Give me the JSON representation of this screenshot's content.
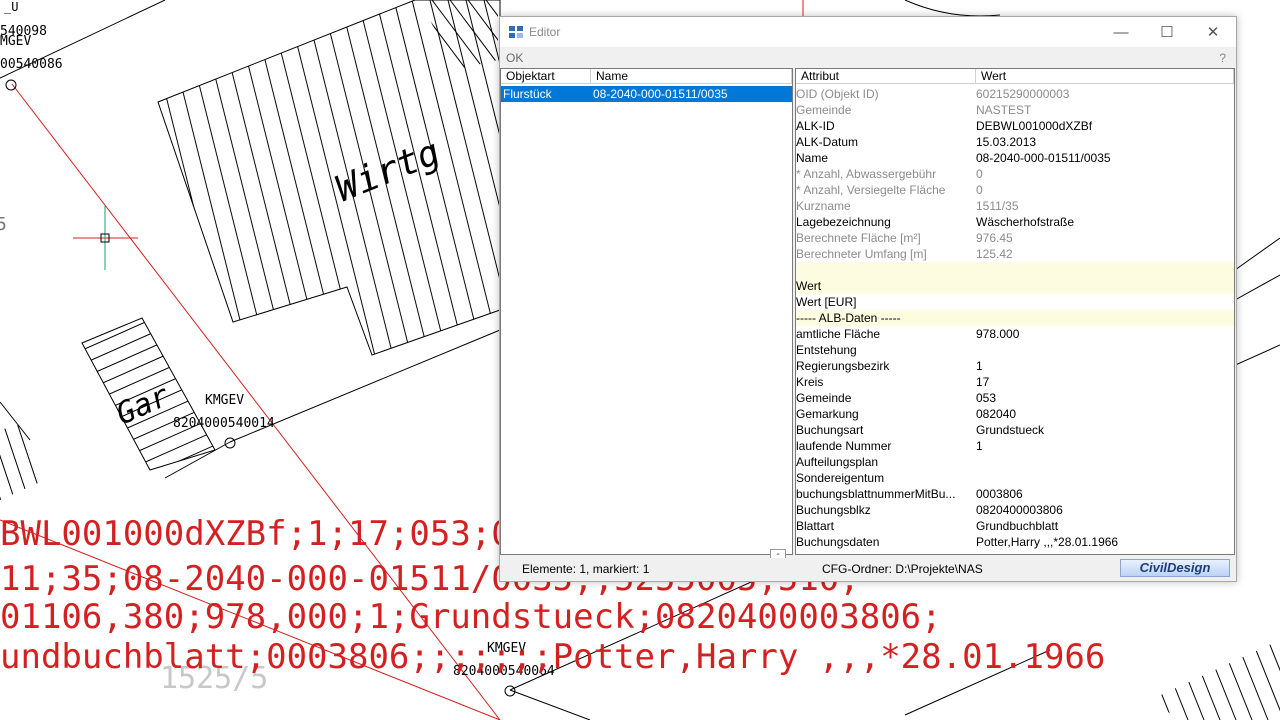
{
  "editor": {
    "title": "Editor",
    "menu_ok": "OK",
    "help": "?",
    "window_buttons": {
      "minimize": "—",
      "maximize": "☐",
      "close": "✕"
    },
    "left_columns": [
      "Objektart",
      "Name"
    ],
    "left_rows": [
      {
        "type": "Flurstück",
        "name": "08-2040-000-01511/0035"
      }
    ],
    "right_columns": [
      "Attribut",
      "Wert"
    ],
    "attributes": [
      {
        "attr": "OID (Objekt ID)",
        "value": "60215290000003",
        "style": "ro"
      },
      {
        "attr": "Gemeinde",
        "value": "NASTEST",
        "style": "ro"
      },
      {
        "attr": "ALK-ID",
        "value": "DEBWL001000dXZBf",
        "style": ""
      },
      {
        "attr": "ALK-Datum",
        "value": "15.03.2013",
        "style": ""
      },
      {
        "attr": "Name",
        "value": "08-2040-000-01511/0035",
        "style": ""
      },
      {
        "attr": "* Anzahl, Abwassergebühr",
        "value": "0",
        "style": "ro"
      },
      {
        "attr": "* Anzahl, Versiegelte Fläche",
        "value": "0",
        "style": "ro"
      },
      {
        "attr": "Kurzname",
        "value": "1511/35",
        "style": "ro"
      },
      {
        "attr": "Lagebezeichnung",
        "value": "Wäscherhofstraße",
        "style": ""
      },
      {
        "attr": "Berechnete Fläche [m²]",
        "value": "976.45",
        "style": "ro"
      },
      {
        "attr": "Berechneter Umfang [m]",
        "value": "125.42",
        "style": "ro"
      },
      {
        "attr": "",
        "value": "",
        "style": "hl"
      },
      {
        "attr": "Wert",
        "value": "",
        "style": "hl"
      },
      {
        "attr": "Wert [EUR]",
        "value": "",
        "style": ""
      },
      {
        "attr": "----- ALB-Daten -----",
        "value": "",
        "style": "hl"
      },
      {
        "attr": "amtliche Fläche",
        "value": "978.000",
        "style": ""
      },
      {
        "attr": "Entstehung",
        "value": "",
        "style": ""
      },
      {
        "attr": "Regierungsbezirk",
        "value": "1",
        "style": ""
      },
      {
        "attr": "Kreis",
        "value": "17",
        "style": ""
      },
      {
        "attr": "Gemeinde",
        "value": "053",
        "style": ""
      },
      {
        "attr": "Gemarkung",
        "value": "082040",
        "style": ""
      },
      {
        "attr": "Buchungsart",
        "value": "Grundstueck",
        "style": ""
      },
      {
        "attr": "laufende Nummer",
        "value": "1",
        "style": ""
      },
      {
        "attr": "Aufteilungsplan",
        "value": "",
        "style": ""
      },
      {
        "attr": "Sondereigentum",
        "value": "",
        "style": ""
      },
      {
        "attr": "buchungsblattnummerMitBu...",
        "value": "0003806",
        "style": ""
      },
      {
        "attr": "Buchungsblkz",
        "value": "0820400003806",
        "style": ""
      },
      {
        "attr": "Blattart",
        "value": "Grundbuchblatt",
        "style": ""
      },
      {
        "attr": "Buchungsdaten",
        "value": "Potter,Harry ,,,*28.01.1966",
        "style": ""
      }
    ],
    "status_left": "Elemente: 1, markiert: 1",
    "status_right": "CFG-Ordner:   D:\\Projekte\\NAS",
    "logo": "CivilDesign",
    "splitter": "-"
  },
  "cad": {
    "labels": {
      "top1": "_U",
      "top2": "540098",
      "top3": "MGEV",
      "top4": "00540086",
      "wirtg": "Wirtg",
      "gar": "Gar",
      "kmgev1": "KMGEV",
      "num1": "8204000540014",
      "kmgev2": "KMGEV",
      "num2": "8204000540064",
      "parcel": "1525/5",
      "left5": "5"
    },
    "big_lines": [
      "BWL001000dXZBf;1;17;053;0",
      "11;35;08-2040-000-01511/0035;;5255005;510;",
      "01106,380;978,000;1;Grundstueck;0820400003806;",
      "undbuchblatt;0003806;;;;;;;Potter,Harry ,,,*28.01.1966"
    ]
  }
}
